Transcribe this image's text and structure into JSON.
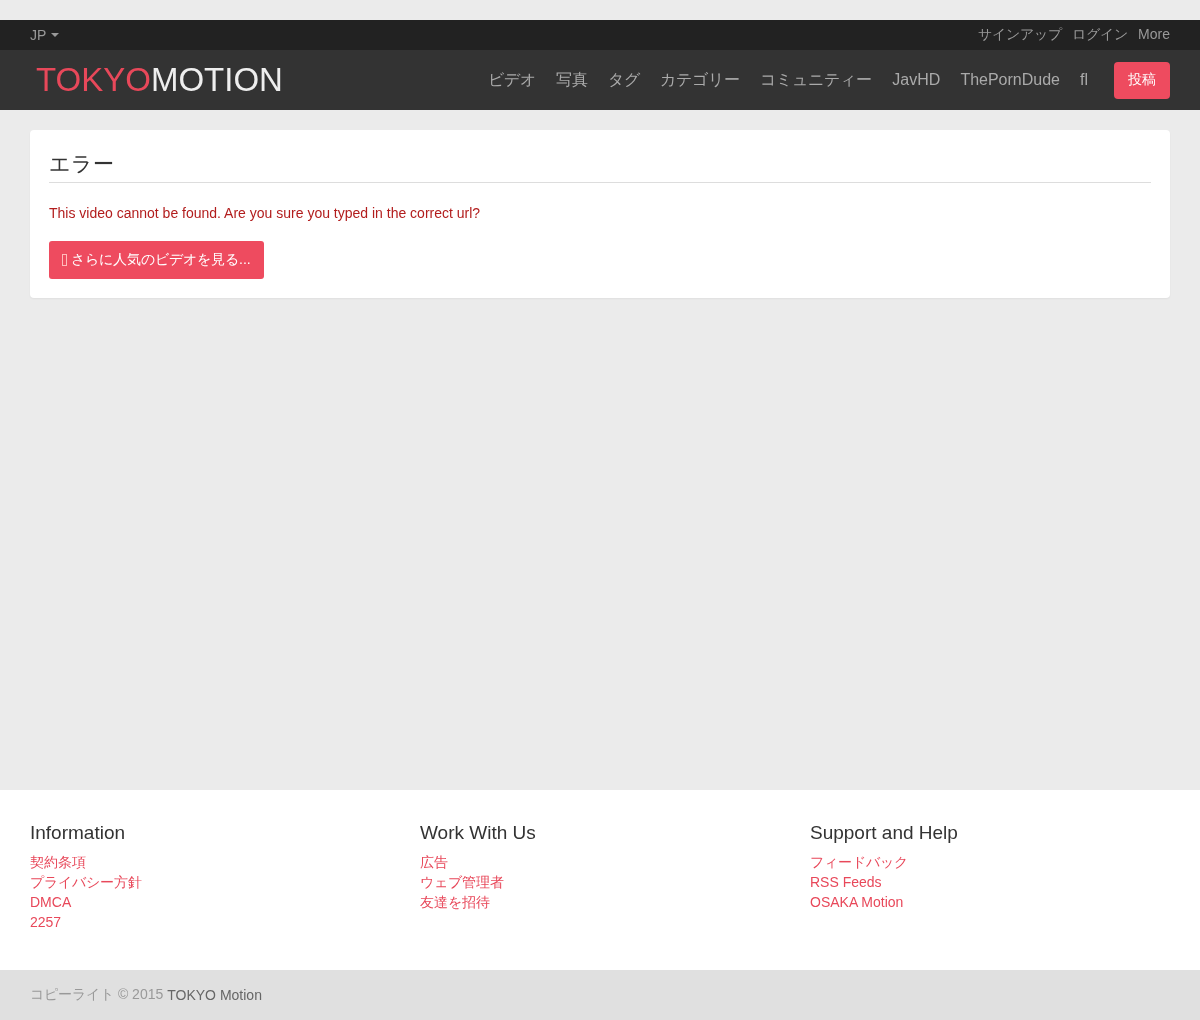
{
  "topbar": {
    "language": "JP",
    "links": [
      "サインアップ",
      "ログイン",
      "More"
    ]
  },
  "navbar": {
    "logo": {
      "first": "TOKYO",
      "second": "MOTION"
    },
    "items": [
      "ビデオ",
      "写真",
      "タグ",
      "カテゴリー",
      "コミュニティー",
      "JavHD",
      "ThePornDude",
      "fl"
    ],
    "upload_button": "投稿"
  },
  "error_card": {
    "title": "エラー",
    "message": "This video cannot be found. Are you sure you typed in the correct url?",
    "button": "さらに人気のビデオを見る..."
  },
  "footer": {
    "columns": [
      {
        "heading": "Information",
        "links": [
          "契約条項",
          "プライバシー方針",
          "DMCA",
          "2257"
        ]
      },
      {
        "heading": "Work With Us",
        "links": [
          "広告",
          "ウェブ管理者",
          "友達を招待"
        ]
      },
      {
        "heading": "Support and Help",
        "links": [
          "フィードバック",
          "RSS Feeds",
          "OSAKA Motion"
        ]
      }
    ]
  },
  "copyright": {
    "text": "コピーライト © 2015",
    "brand": "TOKYO Motion"
  }
}
